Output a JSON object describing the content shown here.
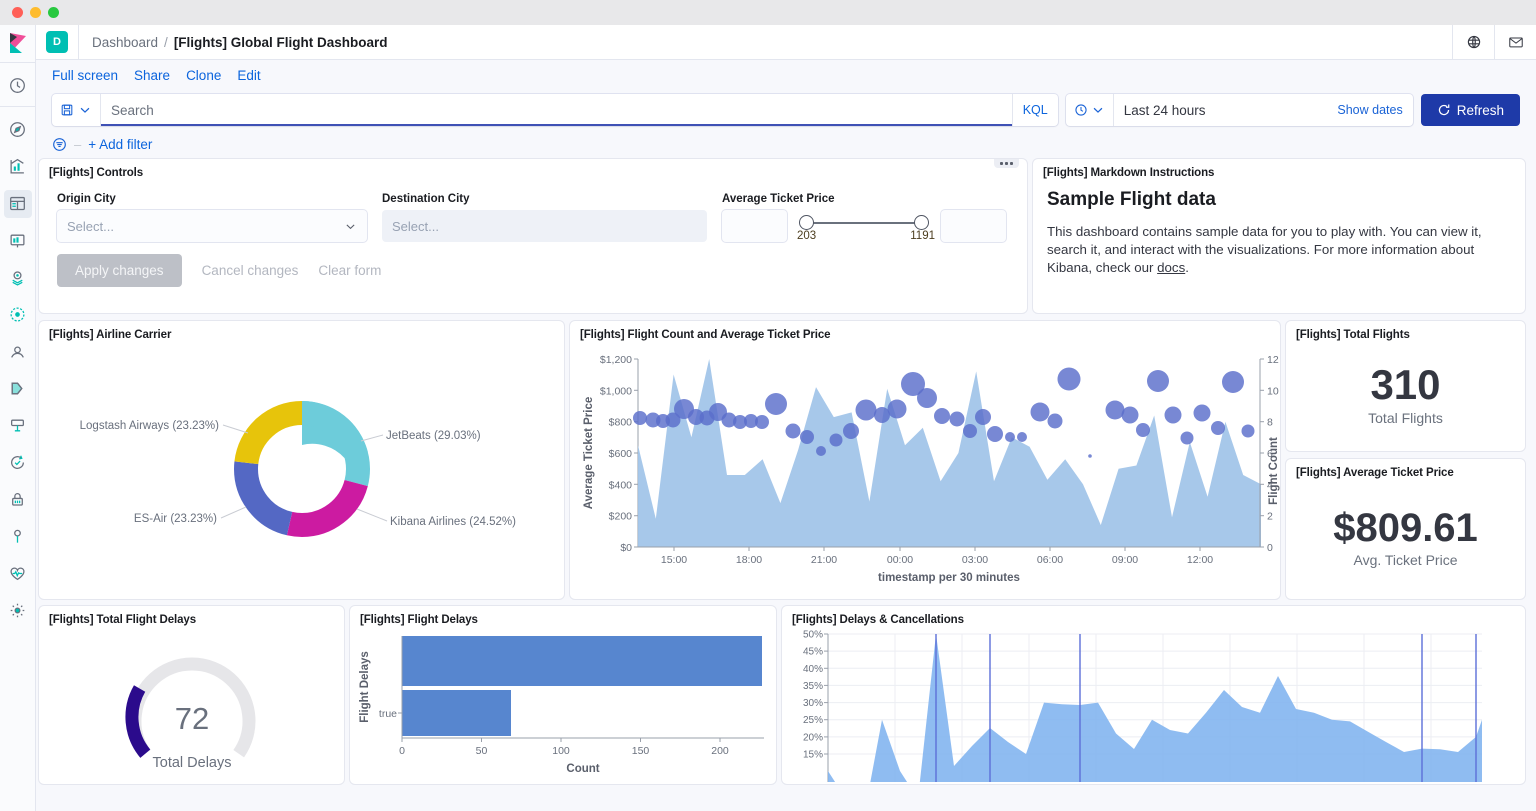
{
  "window": {
    "title": "Kibana"
  },
  "topbar": {
    "space_badge": "D",
    "breadcrumb_parent": "Dashboard",
    "breadcrumb_sep": "/",
    "breadcrumb_current": "[Flights] Global Flight Dashboard",
    "icons": [
      "help-globe-icon",
      "mail-icon"
    ]
  },
  "sidebar": {
    "logo": "kibana-logo",
    "items": [
      {
        "name": "recently-viewed",
        "icon": "clock-icon",
        "active": false
      },
      {
        "name": "discover",
        "icon": "compass-icon",
        "active": false
      },
      {
        "name": "visualize",
        "icon": "bar-chart-icon",
        "active": false
      },
      {
        "name": "dashboard",
        "icon": "dashboard-icon",
        "active": true
      },
      {
        "name": "canvas",
        "icon": "presentation-icon",
        "active": false
      },
      {
        "name": "maps",
        "icon": "map-marker-icon",
        "active": false
      },
      {
        "name": "machine-learning",
        "icon": "node-graph-icon",
        "active": false
      },
      {
        "name": "infrastructure",
        "icon": "user-monitor-icon",
        "active": false
      },
      {
        "name": "logs",
        "icon": "logs-icon",
        "active": false
      },
      {
        "name": "apm",
        "icon": "apm-icon",
        "active": false
      },
      {
        "name": "uptime",
        "icon": "uptime-icon",
        "active": false
      },
      {
        "name": "siem",
        "icon": "lock-icon",
        "active": false
      },
      {
        "name": "dev-tools",
        "icon": "wrench-icon",
        "active": false
      },
      {
        "name": "monitoring",
        "icon": "heart-pulse-icon",
        "active": false
      },
      {
        "name": "management",
        "icon": "gear-icon",
        "active": false
      }
    ]
  },
  "actions": {
    "full_screen": "Full screen",
    "share": "Share",
    "clone": "Clone",
    "edit": "Edit"
  },
  "query": {
    "saved_query_icon": "save-icon",
    "search_placeholder": "Search",
    "search_value": "",
    "language": "KQL",
    "date_icon": "clock-icon",
    "date_range": "Last 24 hours",
    "show_dates": "Show dates",
    "refresh_label": "Refresh",
    "refresh_icon": "refresh-icon"
  },
  "filters": {
    "filter_icon": "filter-icon",
    "dash": "–",
    "add_filter": "+ Add filter"
  },
  "panels": {
    "controls": {
      "title": "[Flights] Controls",
      "menu_icon": "panel-menu-icon",
      "origin_label": "Origin City",
      "origin_placeholder": "Select...",
      "destination_label": "Destination City",
      "destination_placeholder": "Select...",
      "price_label": "Average Ticket Price",
      "price_min": "203",
      "price_max": "1191",
      "apply": "Apply changes",
      "cancel": "Cancel changes",
      "clear": "Clear form"
    },
    "markdown": {
      "title": "[Flights] Markdown Instructions",
      "heading": "Sample Flight data",
      "body_1": "This dashboard contains sample data for you to play with. You can view it, search it, and interact with the visualizations. For more information about Kibana, check our ",
      "link": "docs",
      "body_2": "."
    },
    "airline_carrier": {
      "title": "[Flights] Airline Carrier"
    },
    "flight_count": {
      "title": "[Flights] Flight Count and Average Ticket Price"
    },
    "total_flights": {
      "title": "[Flights] Total Flights",
      "value": "310",
      "label": "Total Flights"
    },
    "avg_ticket_price": {
      "title": "[Flights] Average Ticket Price",
      "value": "$809.61",
      "label": "Avg. Ticket Price"
    },
    "total_flight_delays": {
      "title": "[Flights] Total Flight Delays",
      "value": "72",
      "label": "Total Delays"
    },
    "flight_delays": {
      "title": "[Flights] Flight Delays"
    },
    "delays_cancellations": {
      "title": "[Flights] Delays & Cancellations"
    }
  },
  "colors": {
    "accent": "#0b64dd",
    "refresh_bg": "#1e3aa8",
    "space_badge": "#00bfb3",
    "donut_jetbeats": "#6dccda",
    "donut_kibana": "#cc1ba1",
    "donut_esair": "#5468c4",
    "donut_logstash": "#e7c40b",
    "area_fill": "#9fc3e8",
    "bubble": "#5a6ecb",
    "bar_fill": "#5786cf",
    "gauge_fill": "#2b0b8c",
    "gauge_track": "#e6e6e9",
    "cancel_area": "#7fb3ef",
    "cancel_line": "#5c6fd8"
  },
  "chart_data": [
    {
      "type": "pie",
      "name": "airline-carrier-donut",
      "title": "[Flights] Airline Carrier",
      "donut": true,
      "labels": [
        "JetBeats",
        "Kibana Airlines",
        "ES-Air",
        "Logstash Airways"
      ],
      "values": [
        29.03,
        24.52,
        23.23,
        23.23
      ],
      "display_labels": [
        "JetBeats (29.03%)",
        "Kibana Airlines (24.52%)",
        "ES-Air (23.23%)",
        "Logstash Airways (23.23%)"
      ],
      "colors": [
        "#6dccda",
        "#cc1ba1",
        "#5468c4",
        "#e7c40b"
      ],
      "legend": "labels-with-connectors"
    },
    {
      "type": "area",
      "name": "flight-count-and-avg-ticket-price",
      "title": "[Flights] Flight Count and Average Ticket Price",
      "xlabel": "timestamp per 30 minutes",
      "ylabel": "Average Ticket Price",
      "y2label": "Flight Count",
      "xticks": [
        "15:00",
        "18:00",
        "21:00",
        "00:00",
        "03:00",
        "06:00",
        "09:00",
        "12:00"
      ],
      "yticks": [
        "$0",
        "$200",
        "$400",
        "$600",
        "$800",
        "$1,000",
        "$1,200"
      ],
      "ylim": [
        0,
        1200
      ],
      "y2ticks": [
        "0",
        "2",
        "4",
        "6",
        "8",
        "10",
        "12"
      ],
      "y2lim": [
        0,
        13
      ],
      "grid": false,
      "series": [
        {
          "name": "Average Ticket Price",
          "kind": "area",
          "color": "#9fc3e8",
          "values": [
            650,
            180,
            1100,
            700,
            1200,
            460,
            460,
            560,
            280,
            620,
            1020,
            830,
            860,
            290,
            1010,
            650,
            760,
            420,
            600,
            1120,
            420,
            700,
            640,
            430,
            560,
            400,
            140,
            500,
            520,
            840,
            190,
            670,
            320,
            800,
            460,
            400
          ]
        },
        {
          "name": "Flight Count",
          "kind": "bubble",
          "color": "#5a6ecb",
          "values": [
            8.7,
            8.6,
            8.5,
            8.6,
            9.4,
            8.8,
            8.7,
            9.2,
            8.6,
            8.4,
            8.5,
            8.4,
            9.7,
            7.7,
            7.3,
            6.3,
            7.1,
            7.7,
            9.2,
            8.9,
            9.4,
            11.8,
            10.4,
            8.8,
            8.5,
            7.7,
            8.8,
            7.2,
            7.2,
            9.3,
            8.6,
            12.4,
            6.1,
            9.8,
            9.3,
            11.5,
            9.2,
            7.3,
            11.7,
            8.1,
            7.6
          ]
        }
      ]
    },
    {
      "type": "bar",
      "name": "flight-delays-bar",
      "title": "[Flights] Flight Delays",
      "orientation": "horizontal",
      "ylabel": "Flight Delays",
      "xlabel": "Count",
      "categories": [
        "false",
        "true"
      ],
      "category_tick_labels": [
        "",
        "true"
      ],
      "values": [
        238,
        72
      ],
      "xticks": [
        0,
        50,
        100,
        150,
        200
      ],
      "xlim": [
        0,
        240
      ],
      "color": "#5786cf"
    },
    {
      "type": "gauge",
      "name": "total-flight-delays-gauge",
      "title": "[Flights] Total Flight Delays",
      "value": 72,
      "label": "Total Delays",
      "fill_color": "#2b0b8c",
      "track_color": "#e6e6e9",
      "fraction": 0.13
    },
    {
      "type": "area",
      "name": "delays-and-cancellations",
      "title": "[Flights] Delays & Cancellations",
      "yticks": [
        "15%",
        "20%",
        "25%",
        "30%",
        "35%",
        "40%",
        "45%",
        "50%"
      ],
      "ylim": [
        0,
        50
      ],
      "grid": true,
      "values": [
        10,
        5,
        14,
        26,
        8,
        4,
        50,
        13,
        17,
        22,
        18,
        15,
        30,
        29.5,
        29.3,
        30,
        21,
        16.5,
        25,
        22,
        21,
        27,
        33.5,
        28,
        27,
        37.5,
        29,
        27,
        25,
        24.5,
        22,
        19,
        15.5,
        16.5,
        16.3,
        15.5,
        19,
        25
      ],
      "vertical_markers": [
        6,
        9,
        13,
        33,
        36
      ],
      "area_color": "#7fb3ef",
      "marker_color": "#5c6fd8"
    }
  ]
}
